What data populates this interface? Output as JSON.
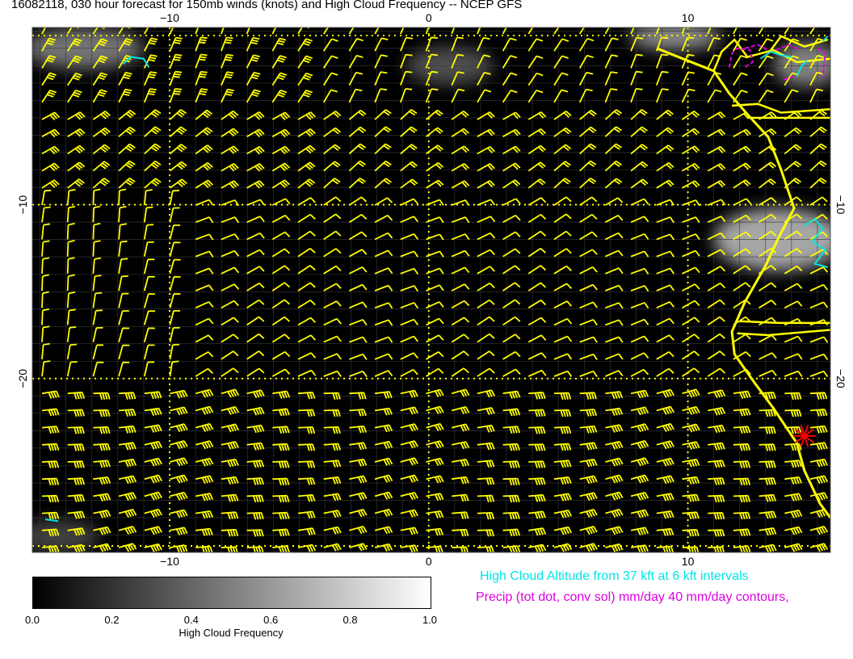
{
  "title": "16082118, 030 hour forecast for 150mb winds (knots) and High Cloud Frequency -- NCEP GFS",
  "axes": {
    "x_ticks": [
      {
        "value": -10,
        "label": "−10"
      },
      {
        "value": 0,
        "label": "0"
      },
      {
        "value": 10,
        "label": "10"
      }
    ],
    "y_ticks": [
      {
        "value": -10,
        "label": "−10"
      },
      {
        "value": -20,
        "label": "−20"
      }
    ],
    "xlim": [
      -15.3,
      15.5
    ],
    "ylim": [
      -30.0,
      0.2
    ]
  },
  "colors": {
    "background": "#000000",
    "barbs": "#ffff00",
    "coast": "#ffff00",
    "cloud_altitude": "#00e5e5",
    "precip": "#e000e0",
    "marker": "#ff0000"
  },
  "legend": {
    "cloud_altitude": "High Cloud Altitude from 37 kft at 6 kft intervals",
    "precip": "Precip (tot dot, conv sol) mm/day 40 mm/day contours,"
  },
  "colorbar": {
    "label": "High Cloud Frequency",
    "ticks": [
      "0.0",
      "0.2",
      "0.4",
      "0.6",
      "0.8",
      "1.0"
    ],
    "range": [
      0.0,
      1.0
    ]
  },
  "chart_data": {
    "type": "map",
    "coastline": [
      [
        8.8,
        -1.0
      ],
      [
        9.8,
        -1.6
      ],
      [
        11.0,
        -2.3
      ],
      [
        11.6,
        -3.6
      ],
      [
        12.3,
        -4.8
      ],
      [
        13.1,
        -6.1
      ],
      [
        13.6,
        -8.0
      ],
      [
        14.1,
        -10.2
      ],
      [
        13.5,
        -11.9
      ],
      [
        13.0,
        -13.5
      ],
      [
        12.2,
        -15.6
      ],
      [
        11.7,
        -17.3
      ],
      [
        11.8,
        -18.6
      ],
      [
        12.6,
        -20.3
      ],
      [
        13.3,
        -21.7
      ],
      [
        14.2,
        -23.7
      ],
      [
        14.5,
        -25.3
      ],
      [
        15.1,
        -27.2
      ],
      [
        15.5,
        -28.0
      ]
    ],
    "borders": [
      [
        [
          12.3,
          -5.0
        ],
        [
          15.5,
          -5.0
        ]
      ],
      [
        [
          11.7,
          -4.3
        ],
        [
          12.7,
          -4.2
        ],
        [
          13.6,
          -4.7
        ],
        [
          15.5,
          -4.5
        ]
      ],
      [
        [
          11.9,
          -17.4
        ],
        [
          13.1,
          -17.5
        ],
        [
          15.5,
          -17.2
        ]
      ],
      [
        [
          12.0,
          -16.7
        ],
        [
          13.5,
          -16.8
        ],
        [
          15.5,
          -16.8
        ]
      ],
      [
        [
          11.0,
          -2.3
        ],
        [
          11.3,
          -1.2
        ],
        [
          11.8,
          -0.5
        ],
        [
          12.3,
          -1.5
        ],
        [
          13.3,
          -1.1
        ],
        [
          14.2,
          -1.8
        ],
        [
          15.5,
          -1.6
        ]
      ],
      [
        [
          13.2,
          -1.1
        ],
        [
          13.6,
          -0.3
        ],
        [
          14.5,
          -0.9
        ],
        [
          15.4,
          -0.5
        ]
      ]
    ],
    "cloud_frequency_patches": [
      {
        "lon": -13.3,
        "lat": -1.0,
        "rx": 2.3,
        "ry": 1.2,
        "value": 0.45
      },
      {
        "lon": 0.8,
        "lat": -2.0,
        "rx": 1.7,
        "ry": 1.1,
        "value": 0.3
      },
      {
        "lon": 9.5,
        "lat": -0.3,
        "rx": 1.8,
        "ry": 0.8,
        "value": 0.55
      },
      {
        "lon": 14.6,
        "lat": -1.9,
        "rx": 1.3,
        "ry": 1.3,
        "value": 0.5
      },
      {
        "lon": 13.5,
        "lat": -12.0,
        "rx": 2.5,
        "ry": 1.8,
        "value": 0.65
      },
      {
        "lon": -14.3,
        "lat": -29.1,
        "rx": 1.6,
        "ry": 1.0,
        "value": 0.25
      }
    ],
    "cloud_altitude_contours": [
      [
        [
          -11.8,
          -1.9
        ],
        [
          -11.5,
          -1.5
        ],
        [
          -11.0,
          -1.6
        ],
        [
          -10.8,
          -2.1
        ]
      ],
      [
        [
          -14.8,
          -28.1
        ],
        [
          -14.3,
          -28.2
        ]
      ],
      [
        [
          12.8,
          -1.6
        ],
        [
          13.2,
          -1.2
        ],
        [
          13.6,
          -1.4
        ],
        [
          14.0,
          -1.5
        ]
      ],
      [
        [
          14.2,
          -2.6
        ],
        [
          14.4,
          -2.0
        ],
        [
          14.6,
          -1.7
        ]
      ],
      [
        [
          14.5,
          -11.2
        ],
        [
          14.9,
          -10.8
        ],
        [
          15.2,
          -11.4
        ],
        [
          14.8,
          -12.1
        ],
        [
          15.3,
          -12.6
        ],
        [
          14.9,
          -13.4
        ],
        [
          15.4,
          -13.6
        ]
      ],
      [
        [
          15.2,
          -0.6
        ],
        [
          15.4,
          -0.3
        ]
      ]
    ],
    "precip_contours": [
      [
        [
          11.6,
          -2.1
        ],
        [
          11.7,
          -1.3
        ],
        [
          11.9,
          -1.0
        ],
        [
          12.4,
          -1.1
        ],
        [
          12.5,
          -1.8
        ],
        [
          12.2,
          -2.1
        ]
      ],
      [
        [
          12.2,
          -1.0
        ],
        [
          12.7,
          -0.8
        ],
        [
          13.1,
          -1.1
        ]
      ],
      [
        [
          13.4,
          -1.1
        ],
        [
          13.9,
          -0.8
        ],
        [
          14.3,
          -1.1
        ]
      ],
      [
        [
          15.0,
          -1.0
        ],
        [
          15.3,
          -1.3
        ],
        [
          15.2,
          -2.7
        ]
      ],
      [
        [
          13.7,
          -2.8
        ],
        [
          14.1,
          -2.6
        ]
      ]
    ],
    "marker": {
      "lon": 14.5,
      "lat": -23.3,
      "symbol": "star"
    },
    "grid": {
      "dotted_lons": [
        -10,
        0,
        10
      ],
      "dotted_lats": [
        -10,
        -20
      ],
      "fine_step": 1
    }
  }
}
